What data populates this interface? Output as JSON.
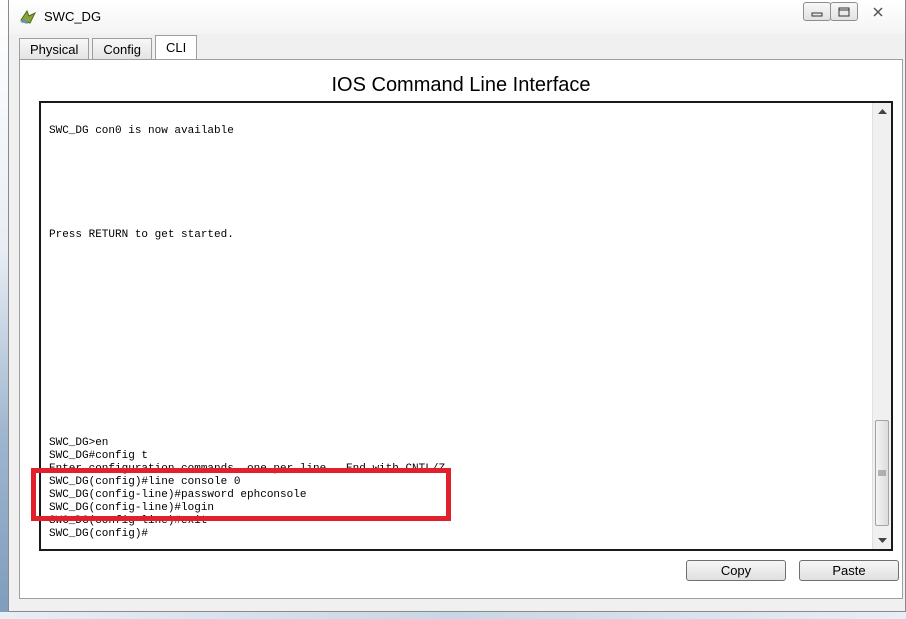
{
  "window": {
    "title": "SWC_DG"
  },
  "tabs": [
    {
      "label": "Physical"
    },
    {
      "label": "Config"
    },
    {
      "label": "CLI"
    }
  ],
  "heading": "IOS Command Line Interface",
  "terminal": {
    "lines": [
      "SWC_DG con0 is now available",
      "",
      "",
      "",
      "",
      "",
      "",
      "",
      "Press RETURN to get started.",
      "",
      "",
      "",
      "",
      "",
      "",
      "",
      "",
      "",
      "",
      "",
      "",
      "",
      "",
      "",
      "SWC_DG>en",
      "SWC_DG#config t",
      "Enter configuration commands, one per line.  End with CNTL/Z.",
      "SWC_DG(config)#line console 0",
      "SWC_DG(config-line)#password ephconsole",
      "SWC_DG(config-line)#login",
      "SWC_DG(config-line)#exit",
      "SWC_DG(config)#"
    ]
  },
  "buttons": {
    "copy": "Copy",
    "paste": "Paste"
  },
  "colors": {
    "highlight": "#e0202a"
  }
}
